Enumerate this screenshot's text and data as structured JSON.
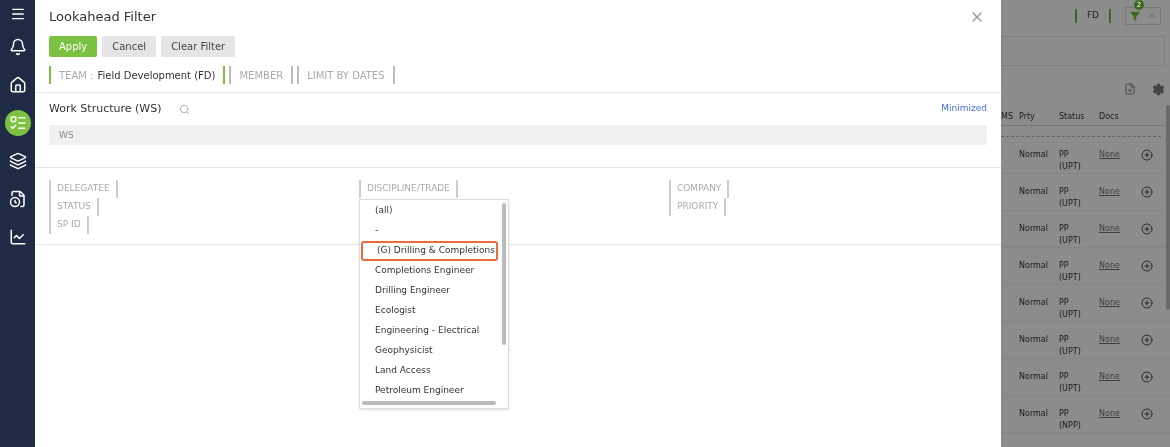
{
  "sidebar": {
    "items": [
      {
        "kind": "bell",
        "selected": false
      },
      {
        "kind": "home",
        "selected": false
      },
      {
        "kind": "tasks",
        "selected": true
      },
      {
        "kind": "layers",
        "selected": false
      },
      {
        "kind": "report",
        "selected": false
      },
      {
        "kind": "chart",
        "selected": false
      }
    ]
  },
  "dialog": {
    "title": "Lookahead Filter",
    "buttons": [
      {
        "label": "Apply",
        "kind": "primary"
      },
      {
        "label": "Cancel",
        "kind": "secondary"
      },
      {
        "label": "Clear Filter",
        "kind": "secondary"
      }
    ],
    "top_filters": [
      {
        "label": "TEAM :",
        "value": "Field Development (FD)",
        "active": true
      },
      {
        "label": "MEMBER",
        "active": false
      },
      {
        "label": "LIMIT BY DATES",
        "active": false
      }
    ],
    "work_structure": {
      "title": "Work Structure (WS)",
      "link": "Minimized",
      "placeholder": "WS"
    },
    "filter_columns": [
      [
        {
          "label": "DELEGATEE"
        },
        {
          "label": "STATUS"
        },
        {
          "label": "SP ID"
        }
      ],
      [
        {
          "label": "DISCIPLINE/TRADE"
        }
      ],
      [
        {
          "label": "COMPANY"
        },
        {
          "label": "PRIORITY"
        }
      ]
    ],
    "dropdown": {
      "options": [
        {
          "label": "(all)",
          "selected": false
        },
        {
          "label": "-",
          "selected": false
        },
        {
          "label": "(G) Drilling & Completions",
          "selected": true
        },
        {
          "label": "Completions Engineer",
          "selected": false
        },
        {
          "label": "Drilling Engineer",
          "selected": false
        },
        {
          "label": "Ecologist",
          "selected": false
        },
        {
          "label": "Engineering - Electrical",
          "selected": false
        },
        {
          "label": "Geophysicist",
          "selected": false
        },
        {
          "label": "Land Access",
          "selected": false
        },
        {
          "label": "Petroleum Engineer",
          "selected": false
        }
      ]
    }
  },
  "background": {
    "team": "FD",
    "filter_count": "2",
    "filter_active": true,
    "columns": [
      "MS",
      "Prty",
      "Status",
      "Docs"
    ],
    "rows": [
      {
        "priority": "Normal",
        "status": "PP",
        "status_detail": "(UPT)",
        "docs": "None"
      },
      {
        "priority": "Normal",
        "status": "PP",
        "status_detail": "(UPT)",
        "docs": "None"
      },
      {
        "priority": "Normal",
        "status": "PP",
        "status_detail": "(UPT)",
        "docs": "None"
      },
      {
        "priority": "Normal",
        "status": "PP",
        "status_detail": "(UPT)",
        "docs": "None"
      },
      {
        "priority": "Normal",
        "status": "PP",
        "status_detail": "(UPT)",
        "docs": "None"
      },
      {
        "priority": "Normal",
        "status": "PP",
        "status_detail": "(UPT)",
        "docs": "None"
      },
      {
        "priority": "Normal",
        "status": "PP",
        "status_detail": "(UPT)",
        "docs": "None"
      },
      {
        "priority": "Normal",
        "status": "PP",
        "status_detail": "(NPP)",
        "docs": "None"
      }
    ]
  }
}
